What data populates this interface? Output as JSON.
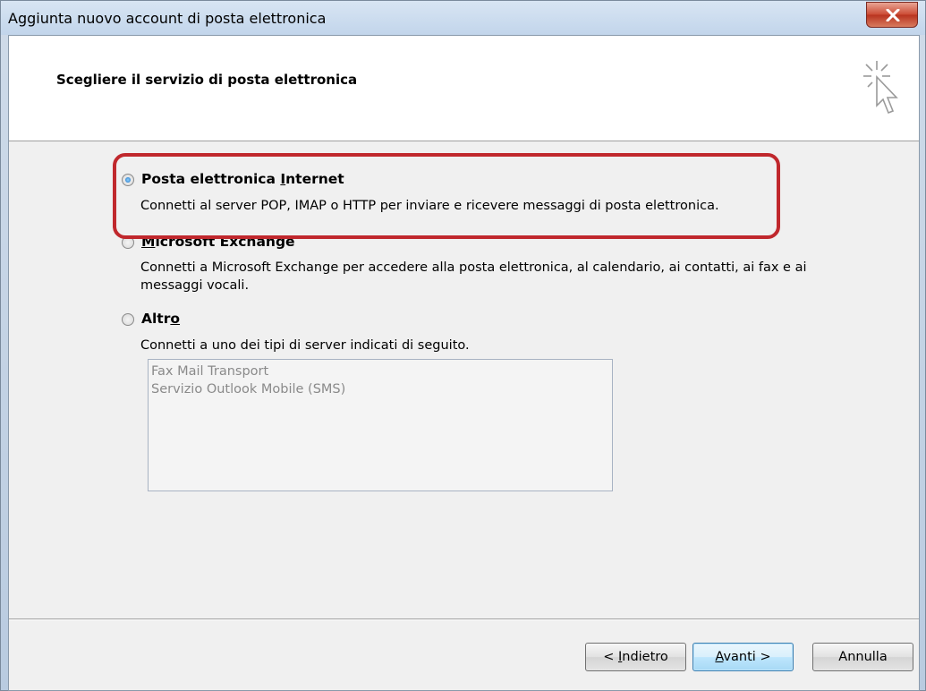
{
  "window": {
    "title": "Aggiunta nuovo account di posta elettronica",
    "close_label": "X"
  },
  "header": {
    "title": "Scegliere il servizio di posta elettronica",
    "icon": "cursor-click-icon"
  },
  "options": [
    {
      "label_prefix": "Posta elettronica ",
      "label_accel": "I",
      "label_suffix": "nternet",
      "description": "Connetti al server POP, IMAP o HTTP per inviare e ricevere messaggi di posta elettronica.",
      "selected": true
    },
    {
      "label_prefix": "",
      "label_accel": "M",
      "label_suffix": "icrosoft Exchange",
      "description_line1": "Connetti a Microsoft Exchange per accedere alla posta elettronica, al calendario, ai contatti, ai fax e ai",
      "description_line2": "messaggi vocali.",
      "selected": false
    },
    {
      "label_prefix": "Altr",
      "label_accel": "o",
      "label_suffix": "",
      "description": "Connetti a uno dei tipi di server indicati di seguito.",
      "selected": false
    }
  ],
  "server_list": {
    "items": [
      "Fax Mail Transport",
      "Servizio Outlook Mobile (SMS)"
    ]
  },
  "buttons": {
    "back_prefix": "< ",
    "back_accel": "I",
    "back_suffix": "ndietro",
    "next_accel": "A",
    "next_suffix": "vanti >",
    "cancel": "Annulla"
  },
  "colors": {
    "highlight": "#c0282d",
    "close_button": "#c8422f",
    "default_button": "#bee6fd"
  }
}
